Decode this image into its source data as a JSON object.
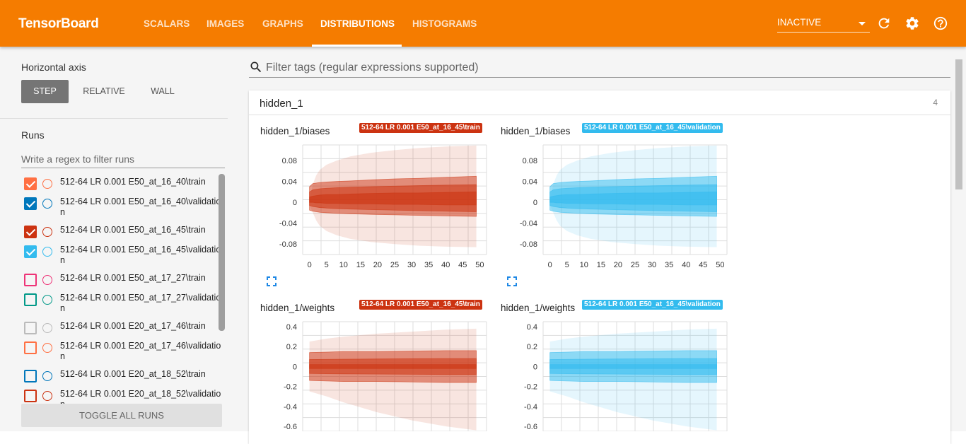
{
  "brand": "TensorBoard",
  "tabs": [
    {
      "label": "SCALARS"
    },
    {
      "label": "IMAGES"
    },
    {
      "label": "GRAPHS"
    },
    {
      "label": "DISTRIBUTIONS",
      "active": true
    },
    {
      "label": "HISTOGRAMS"
    }
  ],
  "status_select": "INACTIVE",
  "icons": {
    "refresh": "refresh-icon",
    "settings": "gear-icon",
    "help": "help-icon",
    "search": "search-icon",
    "expand": "fullscreen-icon"
  },
  "sidebar": {
    "horizontal_axis_label": "Horizontal axis",
    "axis_buttons": [
      {
        "label": "STEP",
        "active": true
      },
      {
        "label": "RELATIVE"
      },
      {
        "label": "WALL"
      }
    ],
    "runs_label": "Runs",
    "runs_filter_placeholder": "Write a regex to filter runs",
    "runs": [
      {
        "name": "512-64 LR 0.001 E50_at_16_40\\train",
        "color": "#ff7043",
        "checked": true
      },
      {
        "name": "512-64 LR 0.001 E50_at_16_40\\validation",
        "color": "#0077bb",
        "checked": true
      },
      {
        "name": "512-64 LR 0.001 E50_at_16_45\\train",
        "color": "#cc3311",
        "checked": true
      },
      {
        "name": "512-64 LR 0.001 E50_at_16_45\\validation",
        "color": "#33bbee",
        "checked": true
      },
      {
        "name": "512-64 LR 0.001 E50_at_17_27\\train",
        "color": "#ee3377",
        "checked": false
      },
      {
        "name": "512-64 LR 0.001 E50_at_17_27\\validation",
        "color": "#009988",
        "checked": false
      },
      {
        "name": "512-64 LR 0.001 E20_at_17_46\\train",
        "color": "#bbbbbb",
        "checked": false
      },
      {
        "name": "512-64 LR 0.001 E20_at_17_46\\validation",
        "color": "#ff7043",
        "checked": false
      },
      {
        "name": "512-64 LR 0.001 E20_at_18_52\\train",
        "color": "#0077bb",
        "checked": false
      },
      {
        "name": "512-64 LR 0.001 E20_at_18_52\\validation",
        "color": "#cc3311",
        "checked": false
      }
    ],
    "toggle_all": "TOGGLE ALL RUNS"
  },
  "main": {
    "tag_filter_placeholder": "Filter tags (regular expressions supported)",
    "category": {
      "name": "hidden_1",
      "count": "4"
    }
  },
  "chart_data": [
    {
      "type": "area",
      "title": "hidden_1/biases",
      "run": "512-64 LR 0.001 E50_at_16_45\\train",
      "color": "#cc3311",
      "x": [
        0,
        5,
        10,
        15,
        20,
        25,
        30,
        35,
        40,
        45,
        50
      ],
      "xlim": [
        -2,
        52
      ],
      "yticks": [
        0.08,
        0.04,
        0,
        -0.04,
        -0.08
      ],
      "ytick_labels": [
        "0.08",
        "0.04",
        "0",
        "-0.04",
        "-0.08"
      ],
      "ylim": [
        -0.1,
        0.11
      ],
      "steps": [
        0,
        1,
        2,
        3,
        5,
        8,
        12,
        18,
        25,
        32,
        40,
        49
      ],
      "bands": [
        {
          "upper": [
            0.005,
            0.035,
            0.052,
            0.062,
            0.072,
            0.08,
            0.088,
            0.095,
            0.1,
            0.104,
            0.107,
            0.109
          ],
          "lower": [
            -0.005,
            -0.02,
            -0.035,
            -0.045,
            -0.055,
            -0.063,
            -0.07,
            -0.076,
            -0.08,
            -0.083,
            -0.085,
            -0.086
          ]
        },
        {
          "upper": [
            0.03,
            0.036,
            0.037,
            0.038,
            0.039,
            0.04,
            0.041,
            0.043,
            0.045,
            0.046,
            0.048,
            0.05
          ],
          "lower": [
            -0.015,
            -0.017,
            -0.018,
            -0.019,
            -0.02,
            -0.021,
            -0.022,
            -0.023,
            -0.024,
            -0.025,
            -0.026,
            -0.027
          ]
        },
        {
          "upper": [
            0.02,
            0.024,
            0.025,
            0.026,
            0.027,
            0.028,
            0.029,
            0.03,
            0.031,
            0.032,
            0.033,
            0.034
          ],
          "lower": [
            -0.006,
            -0.008,
            -0.009,
            -0.01,
            -0.011,
            -0.012,
            -0.013,
            -0.014,
            -0.015,
            -0.016,
            -0.017,
            -0.018
          ]
        },
        {
          "upper": [
            0.01,
            0.012,
            0.013,
            0.014,
            0.015,
            0.015,
            0.016,
            0.017,
            0.018,
            0.018,
            0.019,
            0.02
          ],
          "lower": [
            0.0,
            0.0,
            -0.001,
            -0.001,
            -0.002,
            -0.002,
            -0.003,
            -0.003,
            -0.004,
            -0.004,
            -0.005,
            -0.005
          ]
        }
      ]
    },
    {
      "type": "area",
      "title": "hidden_1/biases",
      "run": "512-64 LR 0.001 E50_at_16_45\\validation",
      "color": "#33bbee",
      "x": [
        0,
        5,
        10,
        15,
        20,
        25,
        30,
        35,
        40,
        45,
        50
      ],
      "xlim": [
        -2,
        52
      ],
      "yticks": [
        0.08,
        0.04,
        0,
        -0.04,
        -0.08
      ],
      "ytick_labels": [
        "0.08",
        "0.04",
        "0",
        "-0.04",
        "-0.08"
      ],
      "ylim": [
        -0.1,
        0.11
      ],
      "steps": [
        0,
        1,
        2,
        3,
        5,
        8,
        12,
        18,
        25,
        32,
        40,
        49
      ],
      "bands": [
        {
          "upper": [
            0.005,
            0.035,
            0.052,
            0.062,
            0.072,
            0.08,
            0.088,
            0.095,
            0.1,
            0.104,
            0.107,
            0.109
          ],
          "lower": [
            -0.005,
            -0.02,
            -0.035,
            -0.045,
            -0.055,
            -0.063,
            -0.07,
            -0.076,
            -0.08,
            -0.083,
            -0.085,
            -0.086
          ]
        },
        {
          "upper": [
            0.03,
            0.036,
            0.037,
            0.038,
            0.039,
            0.04,
            0.041,
            0.043,
            0.045,
            0.046,
            0.048,
            0.05
          ],
          "lower": [
            -0.015,
            -0.017,
            -0.018,
            -0.019,
            -0.02,
            -0.021,
            -0.022,
            -0.023,
            -0.024,
            -0.025,
            -0.026,
            -0.027
          ]
        },
        {
          "upper": [
            0.02,
            0.024,
            0.025,
            0.026,
            0.027,
            0.028,
            0.029,
            0.03,
            0.031,
            0.032,
            0.033,
            0.034
          ],
          "lower": [
            -0.006,
            -0.008,
            -0.009,
            -0.01,
            -0.011,
            -0.012,
            -0.013,
            -0.014,
            -0.015,
            -0.016,
            -0.017,
            -0.018
          ]
        },
        {
          "upper": [
            0.01,
            0.012,
            0.013,
            0.014,
            0.015,
            0.015,
            0.016,
            0.017,
            0.018,
            0.018,
            0.019,
            0.02
          ],
          "lower": [
            0.0,
            0.0,
            -0.001,
            -0.001,
            -0.002,
            -0.002,
            -0.003,
            -0.003,
            -0.004,
            -0.004,
            -0.005,
            -0.005
          ]
        }
      ]
    },
    {
      "type": "area",
      "title": "hidden_1/weights",
      "run": "512-64 LR 0.001 E50_at_16_45\\train",
      "color": "#cc3311",
      "x": [
        0,
        5,
        10,
        15,
        20,
        25,
        30,
        35,
        40,
        45,
        50
      ],
      "xlim": [
        -2,
        52
      ],
      "yticks": [
        0.4,
        0.2,
        0,
        -0.2,
        -0.4,
        -0.6
      ],
      "ytick_labels": [
        "0.4",
        "0.2",
        "0",
        "-0.2",
        "-0.4",
        "-0.6"
      ],
      "ylim": [
        -0.65,
        0.45
      ],
      "steps": [
        0,
        5,
        10,
        20,
        30,
        40,
        49
      ],
      "bands": [
        {
          "upper": [
            0.25,
            0.28,
            0.3,
            0.33,
            0.35,
            0.37,
            0.38
          ],
          "lower": [
            -0.25,
            -0.3,
            -0.36,
            -0.46,
            -0.54,
            -0.6,
            -0.64
          ]
        },
        {
          "upper": [
            0.14,
            0.145,
            0.15,
            0.15,
            0.155,
            0.16,
            0.16
          ],
          "lower": [
            -0.14,
            -0.145,
            -0.15,
            -0.15,
            -0.155,
            -0.16,
            -0.16
          ]
        },
        {
          "upper": [
            0.07,
            0.072,
            0.074,
            0.076,
            0.078,
            0.08,
            0.08
          ],
          "lower": [
            -0.07,
            -0.072,
            -0.074,
            -0.076,
            -0.078,
            -0.08,
            -0.08
          ]
        },
        {
          "upper": [
            0.02,
            0.02,
            0.02,
            0.02,
            0.02,
            0.02,
            0.02
          ],
          "lower": [
            -0.02,
            -0.02,
            -0.02,
            -0.02,
            -0.02,
            -0.02,
            -0.02
          ]
        }
      ]
    },
    {
      "type": "area",
      "title": "hidden_1/weights",
      "run": "512-64 LR 0.001 E50_at_16_45\\validation",
      "color": "#33bbee",
      "x": [
        0,
        5,
        10,
        15,
        20,
        25,
        30,
        35,
        40,
        45,
        50
      ],
      "xlim": [
        -2,
        52
      ],
      "yticks": [
        0.4,
        0.2,
        0,
        -0.2,
        -0.4,
        -0.6
      ],
      "ytick_labels": [
        "0.4",
        "0.2",
        "0",
        "-0.2",
        "-0.4",
        "-0.6"
      ],
      "ylim": [
        -0.65,
        0.45
      ],
      "steps": [
        0,
        5,
        10,
        20,
        30,
        40,
        49
      ],
      "bands": [
        {
          "upper": [
            0.25,
            0.28,
            0.3,
            0.33,
            0.35,
            0.37,
            0.38
          ],
          "lower": [
            -0.25,
            -0.3,
            -0.36,
            -0.46,
            -0.54,
            -0.6,
            -0.64
          ]
        },
        {
          "upper": [
            0.14,
            0.145,
            0.15,
            0.15,
            0.155,
            0.16,
            0.16
          ],
          "lower": [
            -0.14,
            -0.145,
            -0.15,
            -0.15,
            -0.155,
            -0.16,
            -0.16
          ]
        },
        {
          "upper": [
            0.07,
            0.072,
            0.074,
            0.076,
            0.078,
            0.08,
            0.08
          ],
          "lower": [
            -0.07,
            -0.072,
            -0.074,
            -0.076,
            -0.078,
            -0.08,
            -0.08
          ]
        },
        {
          "upper": [
            0.02,
            0.02,
            0.02,
            0.02,
            0.02,
            0.02,
            0.02
          ],
          "lower": [
            -0.02,
            -0.02,
            -0.02,
            -0.02,
            -0.02,
            -0.02,
            -0.02
          ]
        }
      ]
    }
  ]
}
